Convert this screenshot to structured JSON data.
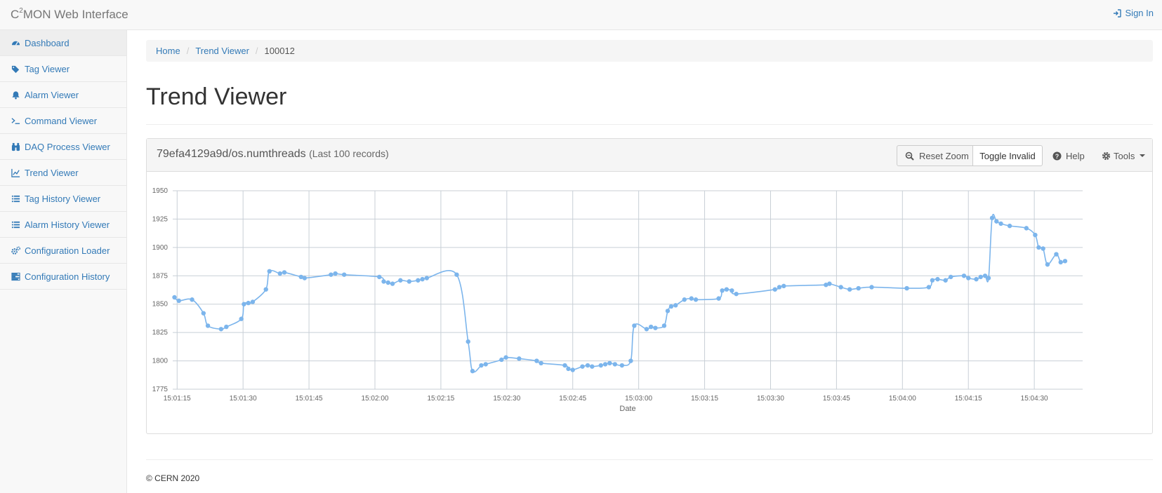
{
  "navbar": {
    "brand_prefix": "C",
    "brand_sup": "2",
    "brand_suffix": "MON Web Interface",
    "signin_label": "Sign In"
  },
  "sidebar": {
    "items": [
      {
        "label": "Dashboard",
        "icon": "dashboard-icon"
      },
      {
        "label": "Tag Viewer",
        "icon": "tags-icon"
      },
      {
        "label": "Alarm Viewer",
        "icon": "bell-icon"
      },
      {
        "label": "Command Viewer",
        "icon": "terminal-icon"
      },
      {
        "label": "DAQ Process Viewer",
        "icon": "binoculars-icon"
      },
      {
        "label": "Trend Viewer",
        "icon": "line-chart-icon"
      },
      {
        "label": "Tag History Viewer",
        "icon": "list-icon"
      },
      {
        "label": "Alarm History Viewer",
        "icon": "list-icon"
      },
      {
        "label": "Configuration Loader",
        "icon": "cogs-icon"
      },
      {
        "label": "Configuration History",
        "icon": "tasks-icon"
      }
    ]
  },
  "breadcrumb": {
    "home": "Home",
    "section": "Trend Viewer",
    "current": "100012"
  },
  "page": {
    "title": "Trend Viewer"
  },
  "panel": {
    "title": "79efa4129a9d/os.numthreads",
    "subtitle": "(Last 100 records)",
    "reset_zoom": "Reset Zoom",
    "toggle_invalid": "Toggle Invalid",
    "help": "Help",
    "tools": "Tools"
  },
  "colors": {
    "series": "#7cb5ec",
    "grid": "#c8cfd6",
    "link": "#337ab7"
  },
  "chart_data": {
    "type": "line",
    "xlabel": "Date",
    "ylabel": "",
    "ylim": [
      1775,
      1950
    ],
    "yticks": [
      1775,
      1800,
      1825,
      1850,
      1875,
      1900,
      1925,
      1950
    ],
    "xlim": [
      "15:01:14",
      "15:04:41"
    ],
    "xticks": [
      "15:01:15",
      "15:01:30",
      "15:01:45",
      "15:02:00",
      "15:02:15",
      "15:02:30",
      "15:02:45",
      "15:03:00",
      "15:03:15",
      "15:03:30",
      "15:03:45",
      "15:04:00",
      "15:04:15",
      "15:04:30"
    ],
    "grid": true,
    "series": [
      {
        "points": [
          [
            "15:01:14.4",
            1856
          ],
          [
            "15:01:15.4",
            1853
          ],
          [
            "15:01:18.4",
            1854
          ],
          [
            "15:01:21.0",
            1842
          ],
          [
            "15:01:22.0",
            1831
          ],
          [
            "15:01:25.0",
            1828
          ],
          [
            "15:01:26.2",
            1830
          ],
          [
            "15:01:29.6",
            1837
          ],
          [
            "15:01:30.2",
            1850
          ],
          [
            "15:01:31.2",
            1851
          ],
          [
            "15:01:32.2",
            1852
          ],
          [
            "15:01:35.2",
            1863
          ],
          [
            "15:01:36.0",
            1879
          ],
          [
            "15:01:38.4",
            1877
          ],
          [
            "15:01:39.4",
            1878
          ],
          [
            "15:01:43.2",
            1874
          ],
          [
            "15:01:44.0",
            1873
          ],
          [
            "15:01:50.0",
            1876
          ],
          [
            "15:01:51.0",
            1877
          ],
          [
            "15:01:53.0",
            1876
          ],
          [
            "15:02:01.0",
            1874
          ],
          [
            "15:02:02.0",
            1870
          ],
          [
            "15:02:03.0",
            1869
          ],
          [
            "15:02:04.0",
            1868
          ],
          [
            "15:02:05.8",
            1871
          ],
          [
            "15:02:07.8",
            1870
          ],
          [
            "15:02:09.8",
            1871
          ],
          [
            "15:02:10.8",
            1872
          ],
          [
            "15:02:11.8",
            1873
          ],
          [
            "15:02:18.6",
            1876
          ],
          [
            "15:02:21.2",
            1817
          ],
          [
            "15:02:22.2",
            1791
          ],
          [
            "15:02:24.2",
            1796
          ],
          [
            "15:02:25.2",
            1797
          ],
          [
            "15:02:28.8",
            1801
          ],
          [
            "15:02:29.8",
            1803
          ],
          [
            "15:02:32.8",
            1802
          ],
          [
            "15:02:36.8",
            1800
          ],
          [
            "15:02:37.8",
            1798
          ],
          [
            "15:02:43.2",
            1796
          ],
          [
            "15:02:44.0",
            1793
          ],
          [
            "15:02:45.0",
            1792
          ],
          [
            "15:02:47.2",
            1795
          ],
          [
            "15:02:48.4",
            1796
          ],
          [
            "15:02:49.4",
            1795
          ],
          [
            "15:02:51.4",
            1796
          ],
          [
            "15:02:52.4",
            1797
          ],
          [
            "15:02:53.4",
            1798
          ],
          [
            "15:02:54.6",
            1797
          ],
          [
            "15:02:56.2",
            1796
          ],
          [
            "15:02:58.2",
            1800
          ],
          [
            "15:02:59.0",
            1831
          ],
          [
            "15:03:01.8",
            1828
          ],
          [
            "15:03:02.8",
            1830
          ],
          [
            "15:03:03.8",
            1829
          ],
          [
            "15:03:05.8",
            1831
          ],
          [
            "15:03:06.6",
            1844
          ],
          [
            "15:03:07.4",
            1848
          ],
          [
            "15:03:08.4",
            1849
          ],
          [
            "15:03:10.4",
            1854
          ],
          [
            "15:03:12.0",
            1855
          ],
          [
            "15:03:13.0",
            1854
          ],
          [
            "15:03:18.2",
            1855
          ],
          [
            "15:03:19.0",
            1862
          ],
          [
            "15:03:20.0",
            1863
          ],
          [
            "15:03:21.2",
            1862
          ],
          [
            "15:03:22.2",
            1859
          ],
          [
            "15:03:31.0",
            1863
          ],
          [
            "15:03:32.0",
            1865
          ],
          [
            "15:03:33.0",
            1866
          ],
          [
            "15:03:42.6",
            1867
          ],
          [
            "15:03:43.4",
            1868
          ],
          [
            "15:03:46.0",
            1865
          ],
          [
            "15:03:48.0",
            1863
          ],
          [
            "15:03:50.0",
            1864
          ],
          [
            "15:03:53.0",
            1865
          ],
          [
            "15:04:01.0",
            1864
          ],
          [
            "15:04:06.0",
            1865
          ],
          [
            "15:04:06.8",
            1871
          ],
          [
            "15:04:08.0",
            1872
          ],
          [
            "15:04:09.8",
            1871
          ],
          [
            "15:04:11.0",
            1874
          ],
          [
            "15:04:14.0",
            1875
          ],
          [
            "15:04:15.0",
            1873
          ],
          [
            "15:04:16.8",
            1872
          ],
          [
            "15:04:17.8",
            1874
          ],
          [
            "15:04:18.8",
            1875
          ],
          [
            "15:04:19.6",
            1873
          ],
          [
            "15:04:20.4",
            1926
          ],
          [
            "15:04:21.4",
            1923
          ],
          [
            "15:04:22.4",
            1921
          ],
          [
            "15:04:24.4",
            1919
          ],
          [
            "15:04:28.2",
            1917
          ],
          [
            "15:04:30.2",
            1911
          ],
          [
            "15:04:31.0",
            1900
          ],
          [
            "15:04:32.0",
            1899
          ],
          [
            "15:04:33.0",
            1885
          ],
          [
            "15:04:35.0",
            1894
          ],
          [
            "15:04:36.0",
            1887
          ],
          [
            "15:04:37.0",
            1888
          ]
        ]
      }
    ]
  },
  "footer": {
    "copyright": "© CERN 2020"
  }
}
